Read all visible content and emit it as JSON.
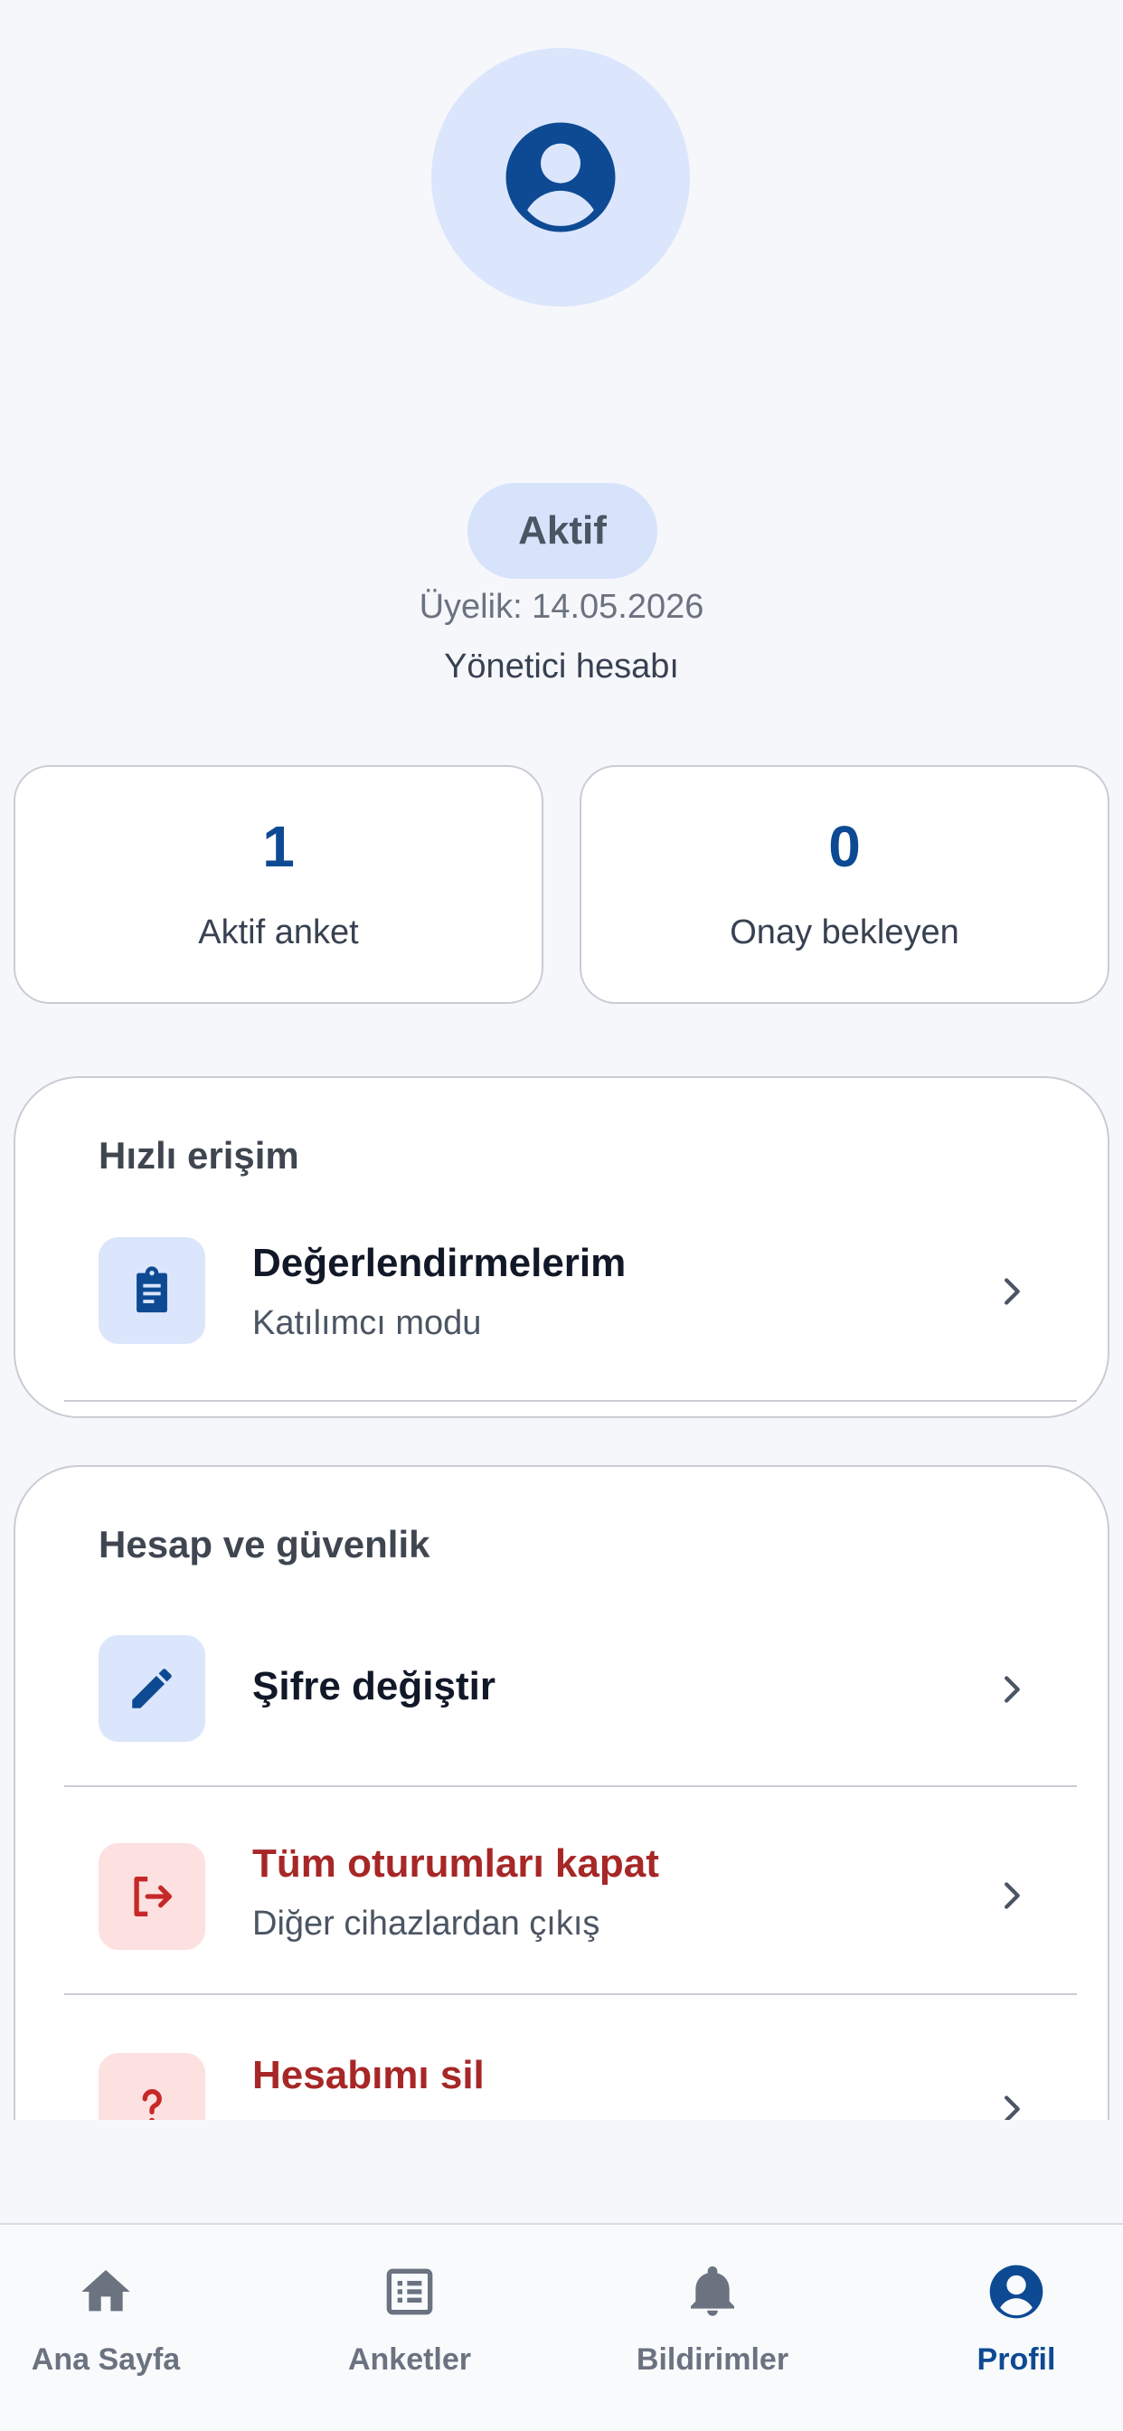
{
  "profile": {
    "status": "Aktif",
    "member_since": "Üyelik: 14.05.2026",
    "account_type": "Yönetici hesabı"
  },
  "stats": [
    {
      "value": "1",
      "label": "Aktif anket"
    },
    {
      "value": "0",
      "label": "Onay bekleyen"
    }
  ],
  "quick_access": {
    "title": "Hızlı erişim",
    "items": [
      {
        "title": "Değerlendirmelerim",
        "subtitle": "Katılımcı modu",
        "icon": "clipboard-icon"
      }
    ]
  },
  "account_security": {
    "title": "Hesap ve güvenlik",
    "items": [
      {
        "title": "Şifre değiştir",
        "icon": "pencil-icon"
      },
      {
        "title": "Tüm oturumları kapat",
        "subtitle": "Diğer cihazlardan çıkış",
        "icon": "logout-icon"
      },
      {
        "title": "Hesabımı sil",
        "icon": "question-icon"
      }
    ]
  },
  "nav": {
    "items": [
      {
        "label": "Ana Sayfa",
        "icon": "home-icon"
      },
      {
        "label": "Anketler",
        "icon": "list-icon"
      },
      {
        "label": "Bildirimler",
        "icon": "bell-icon"
      },
      {
        "label": "Profil",
        "icon": "profile-icon",
        "active": true
      }
    ]
  },
  "colors": {
    "primary": "#0d4a93",
    "danger": "#a72727",
    "icon_bg_blue": "#dbe6fc",
    "icon_bg_red": "#fde0e0",
    "background": "#f6f7fb"
  }
}
